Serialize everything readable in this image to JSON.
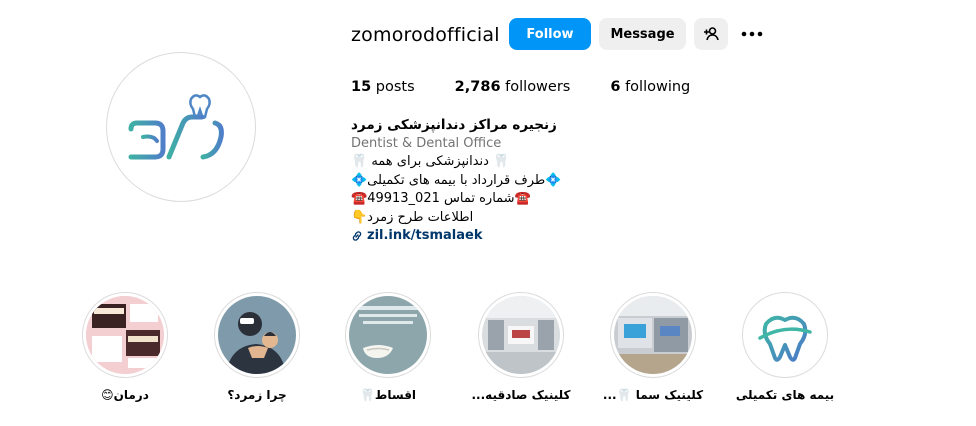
{
  "profile": {
    "username": "zomorodofficial",
    "follow_label": "Follow",
    "message_label": "Message",
    "stats": {
      "posts_count": "15",
      "posts_label": "posts",
      "followers_count": "2,786",
      "followers_label": "followers",
      "following_count": "6",
      "following_label": "following"
    },
    "bio": {
      "name": "زنجیره مراکز دندانپزشکی زمرد",
      "category": "Dentist & Dental Office",
      "line1": "🦷 دندانپزشکی برای همه 🦷",
      "line2": "💠طرف قرارداد با بیمه های تکمیلی💠",
      "line3": "☎️شماره تماس 021_49913☎️",
      "line4": "اطلاعات طرح زمرد👇",
      "link": "zil.ink/tsmalaek"
    }
  },
  "highlights": [
    {
      "label": "درمان😊"
    },
    {
      "label": "چرا زمرد؟"
    },
    {
      "label": "اقساط🦷"
    },
    {
      "label": "کلینیک صادقیه..."
    },
    {
      "label": "کلینیک سما 🦷..."
    },
    {
      "label": "بیمه های تکمیلی"
    }
  ],
  "colors": {
    "follow_bg": "#0095f6",
    "brand_teal": "#3aa7a6",
    "brand_blue": "#4f86c6",
    "link": "#00376b"
  },
  "icons": [
    "add-person-icon",
    "more-options-icon",
    "link-icon",
    "tooth-logo-icon"
  ]
}
